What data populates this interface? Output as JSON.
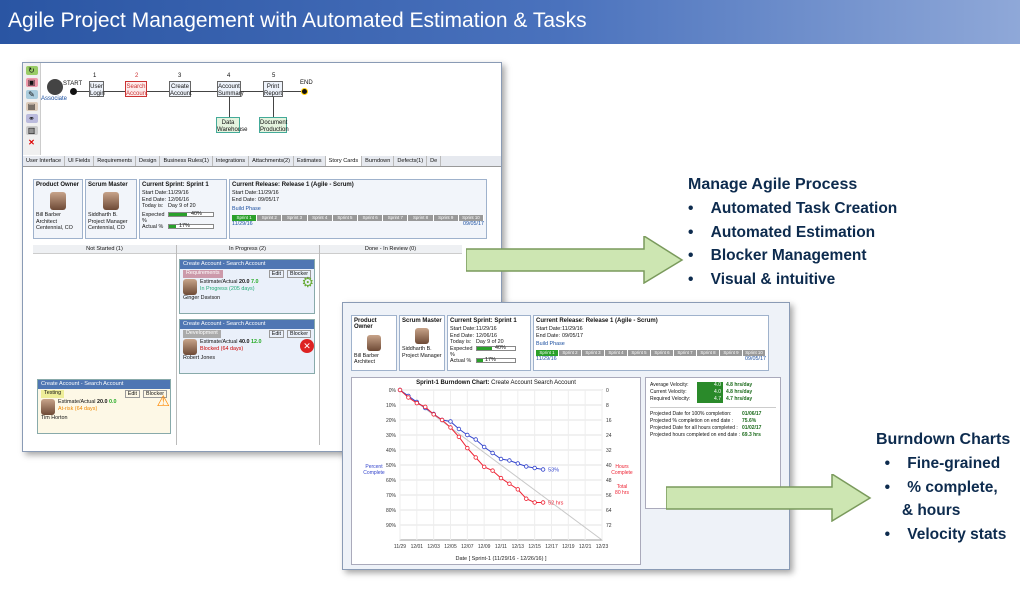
{
  "title": "Agile Project Management with Automated Estimation & Tasks",
  "workflow": {
    "start": "START",
    "end": "END",
    "actor": "Associate",
    "steps": [
      {
        "num": "1",
        "label": "User Login"
      },
      {
        "num": "2",
        "label": "Search Account"
      },
      {
        "num": "3",
        "label": "Create Account"
      },
      {
        "num": "4",
        "label": "Account Summary"
      },
      {
        "num": "5",
        "label": "Print Report"
      }
    ],
    "subs": [
      {
        "label": "Data Warehouse"
      },
      {
        "label": "Document Production"
      }
    ]
  },
  "tabs": [
    "User Interface",
    "UI Fields",
    "Requirements",
    "Design",
    "Business Rules(1)",
    "Integrations",
    "Attachments(2)",
    "Estimates",
    "Story Cards",
    "Burndown",
    "Defects(1)",
    "De"
  ],
  "team": {
    "product_owner": {
      "role": "Product Owner",
      "name": "Bill Barber",
      "title": "Architect",
      "location": "Centennial, CO"
    },
    "scrum_master": {
      "role": "Scrum Master",
      "name": "Siddharth B.",
      "title": "Project Manager",
      "location": "Centennial, CO"
    }
  },
  "sprint": {
    "heading": "Current Sprint:",
    "name": "Sprint 1",
    "start_label": "Start Date:",
    "start": "11/29/16",
    "end_label": "End Date:",
    "end": "12/06/16",
    "today_label": "Today is:",
    "today": "Day 9 of 20",
    "expected_label": "Expected %",
    "expected": "40%",
    "expected_value": 0.4,
    "actual_label": "Actual %",
    "actual": "17%",
    "actual_value": 0.17
  },
  "release": {
    "heading": "Current Release:",
    "name": "Release 1 (Agile - Scrum)",
    "start_label": "Start Date:",
    "start": "11/29/16",
    "end_label": "End Date:",
    "end": "09/05/17",
    "phase": "Build Phase",
    "sprints": [
      "Sprint 1",
      "Sprint 2",
      "Sprint 3",
      "Sprint 4",
      "Sprint 5",
      "Sprint 6",
      "Sprint 7",
      "Sprint 8",
      "Sprint 9",
      "Sprint 10"
    ],
    "range_start": "11/29/16",
    "range_end": "09/05/17"
  },
  "board": {
    "columns": [
      "Not Started (1)",
      "In Progress (2)",
      "Done - In Review (0)"
    ],
    "stories": [
      {
        "title": "Create Account - Search Account",
        "status": "Requirements",
        "edit": "Edit",
        "blocker": "Blocker",
        "name": "Ginger Davison",
        "role": "Business Analyst",
        "loc": "Centennial, CO",
        "est_label": "Estimate/Actual",
        "est": "20.0",
        "act": "7.0",
        "state": "In Progress (205 days)",
        "pct": "3%",
        "pct_value": 0.03,
        "sprint": "Sprint"
      },
      {
        "title": "Create Account - Search Account",
        "status": "Development",
        "edit": "Edit",
        "blocker": "Blocker",
        "name": "Robert Jones",
        "role": "Technical Lead",
        "loc": "Centennial, CO",
        "est_label": "Estimate/Actual",
        "est": "40.0",
        "act": "12.0",
        "state": "Blocked (64 days)",
        "pct": "31%",
        "pct_value": 0.31,
        "sprint": "Sprint"
      },
      {
        "title": "Create Account - Search Account",
        "status": "Testing",
        "edit": "Edit",
        "blocker": "Blocker",
        "name": "Tim Horton",
        "role": "QA Analyst",
        "loc": "Centennial, CO",
        "est_label": "Estimate/Actual",
        "est": "20.0",
        "act": "0.0",
        "state": "At-risk (64 days)",
        "pct": "0%",
        "pct_value": 0,
        "sprint": "Sprint"
      }
    ]
  },
  "burndown": {
    "title": "Sprint-1 Burndown Chart:",
    "subtitle": "Create Account Search Account",
    "left_legend": [
      "Percent",
      "Complete"
    ],
    "right_legend": [
      "Hours",
      "Complete"
    ],
    "total_label": [
      "Total",
      "80 hrs"
    ],
    "pct_label": "53%",
    "hrs_label": "52 hrs",
    "xlabel": "Date [ Sprint-1 (11/29/16 - 12/26/16) ]",
    "y_left": [
      "0%",
      "10%",
      "20%",
      "30%",
      "40%",
      "50%",
      "60%",
      "70%",
      "80%",
      "90%"
    ],
    "y_right": [
      "0",
      "8",
      "16",
      "24",
      "32",
      "40",
      "48",
      "56",
      "64",
      "72"
    ],
    "x_ticks": [
      "11/29",
      "12/01",
      "12/03",
      "12/05",
      "12/07",
      "12/09",
      "12/11",
      "12/13",
      "12/15",
      "12/17",
      "12/19",
      "12/21",
      "12/23"
    ],
    "velocity": [
      {
        "label": "Average Velocity:",
        "value": "4.0",
        "unit": "4.8 hrs/day"
      },
      {
        "label": "Current Velocity:",
        "value": "4.0",
        "unit": "4.8 hrs/day"
      },
      {
        "label": "Required Velocity:",
        "value": "4.7",
        "unit": "4.7 hrs/day"
      }
    ],
    "projections": [
      {
        "label": "Projected Date for 100% completion:",
        "value": "01/06/17"
      },
      {
        "label": "Projected % completion on end date :",
        "value": "75.6%"
      },
      {
        "label": "Projected Date for all hours completed :",
        "value": "01/02/17"
      },
      {
        "label": "Projected hours completed on end date :",
        "value": "69.3 hrs"
      }
    ],
    "chart_data": {
      "type": "line",
      "x": [
        "11/29",
        "11/30",
        "12/01",
        "12/02",
        "12/03",
        "12/04",
        "12/05",
        "12/06",
        "12/07",
        "12/08",
        "12/09",
        "12/10",
        "12/11",
        "12/12",
        "12/13",
        "12/14",
        "12/15",
        "12/16"
      ],
      "series": [
        {
          "name": "Percent Complete",
          "values": [
            0,
            4,
            8,
            12,
            16,
            20,
            21,
            26,
            30,
            33,
            38,
            42,
            46,
            47,
            49,
            51,
            52,
            53
          ]
        },
        {
          "name": "Hours Complete",
          "values": [
            0,
            4,
            7,
            9,
            13,
            16,
            20,
            25,
            31,
            36,
            41,
            43,
            47,
            50,
            53,
            58,
            60,
            60
          ]
        }
      ]
    }
  },
  "bullets1": {
    "heading": "Manage Agile Process",
    "items": [
      "Automated Task Creation",
      "Automated Estimation",
      "Blocker Management",
      "Visual & intuitive"
    ]
  },
  "bullets2": {
    "heading": "Burndown Charts",
    "items": [
      "Fine-grained",
      "% complete,",
      "& hours",
      "Velocity stats"
    ]
  }
}
